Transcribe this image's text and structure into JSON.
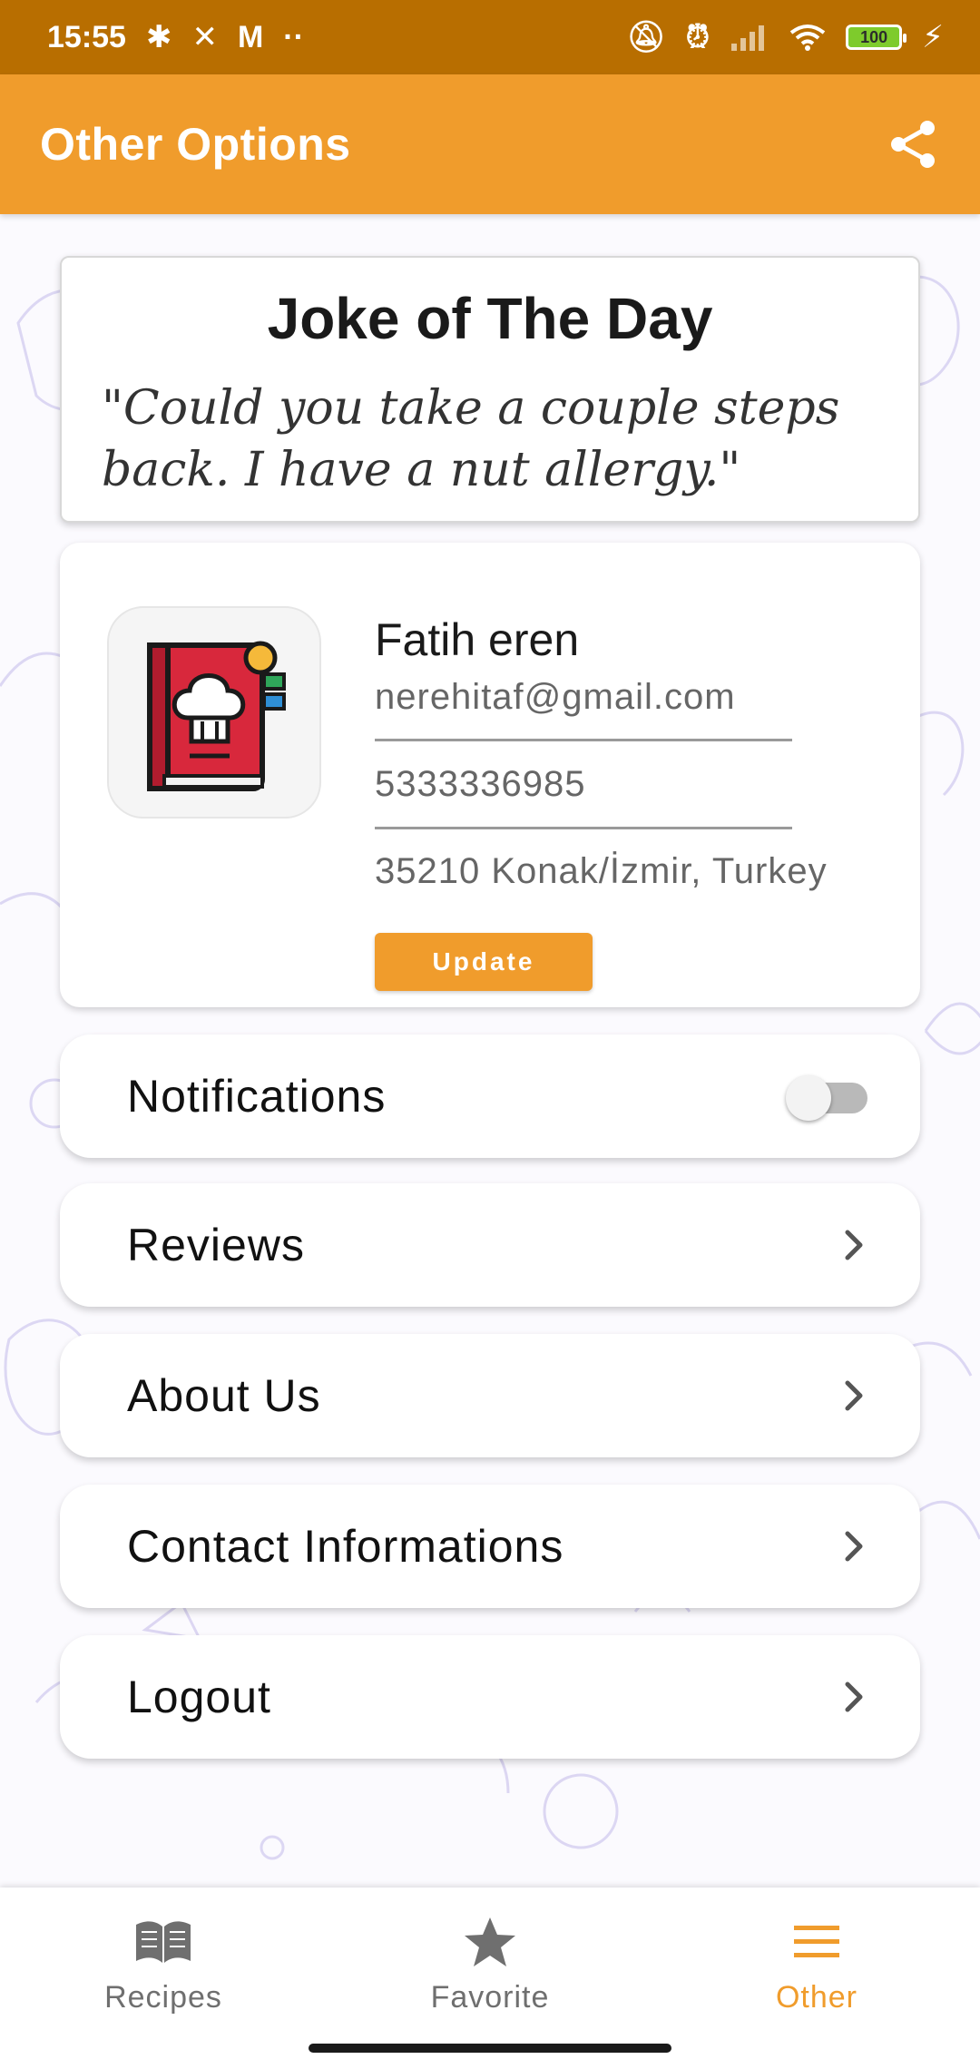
{
  "status_bar": {
    "time": "15:55",
    "battery": "100",
    "icons": [
      "bluetooth-icon",
      "close-icon",
      "gmail-icon",
      "more-dots-icon",
      "mute-icon",
      "alarm-icon",
      "signal-icon",
      "wifi-icon",
      "battery-icon",
      "charging-icon"
    ]
  },
  "app_bar": {
    "title": "Other Options",
    "share_icon": "share-icon",
    "background_color": "#f09c2c"
  },
  "joke": {
    "title": "Joke of The Day",
    "text": "\"Could you take a couple steps back. I have a nut allergy.\""
  },
  "profile": {
    "logo_icon": "chef-cookbook-icon",
    "name": "Fatih eren",
    "email": "nerehitaf@gmail.com",
    "phone": "5333336985",
    "address": "35210 Konak/İzmir, Turkey",
    "update_label": "Update"
  },
  "menu": {
    "notifications_label": "Notifications",
    "notifications_enabled": false,
    "reviews_label": "Reviews",
    "about_label": "About Us",
    "contact_label": "Contact Informations",
    "logout_label": "Logout"
  },
  "bottom_nav": {
    "recipes_label": "Recipes",
    "favorite_label": "Favorite",
    "other_label": "Other",
    "active": "Other",
    "active_color": "#f09c2c",
    "inactive_color": "#6f6f6f"
  }
}
